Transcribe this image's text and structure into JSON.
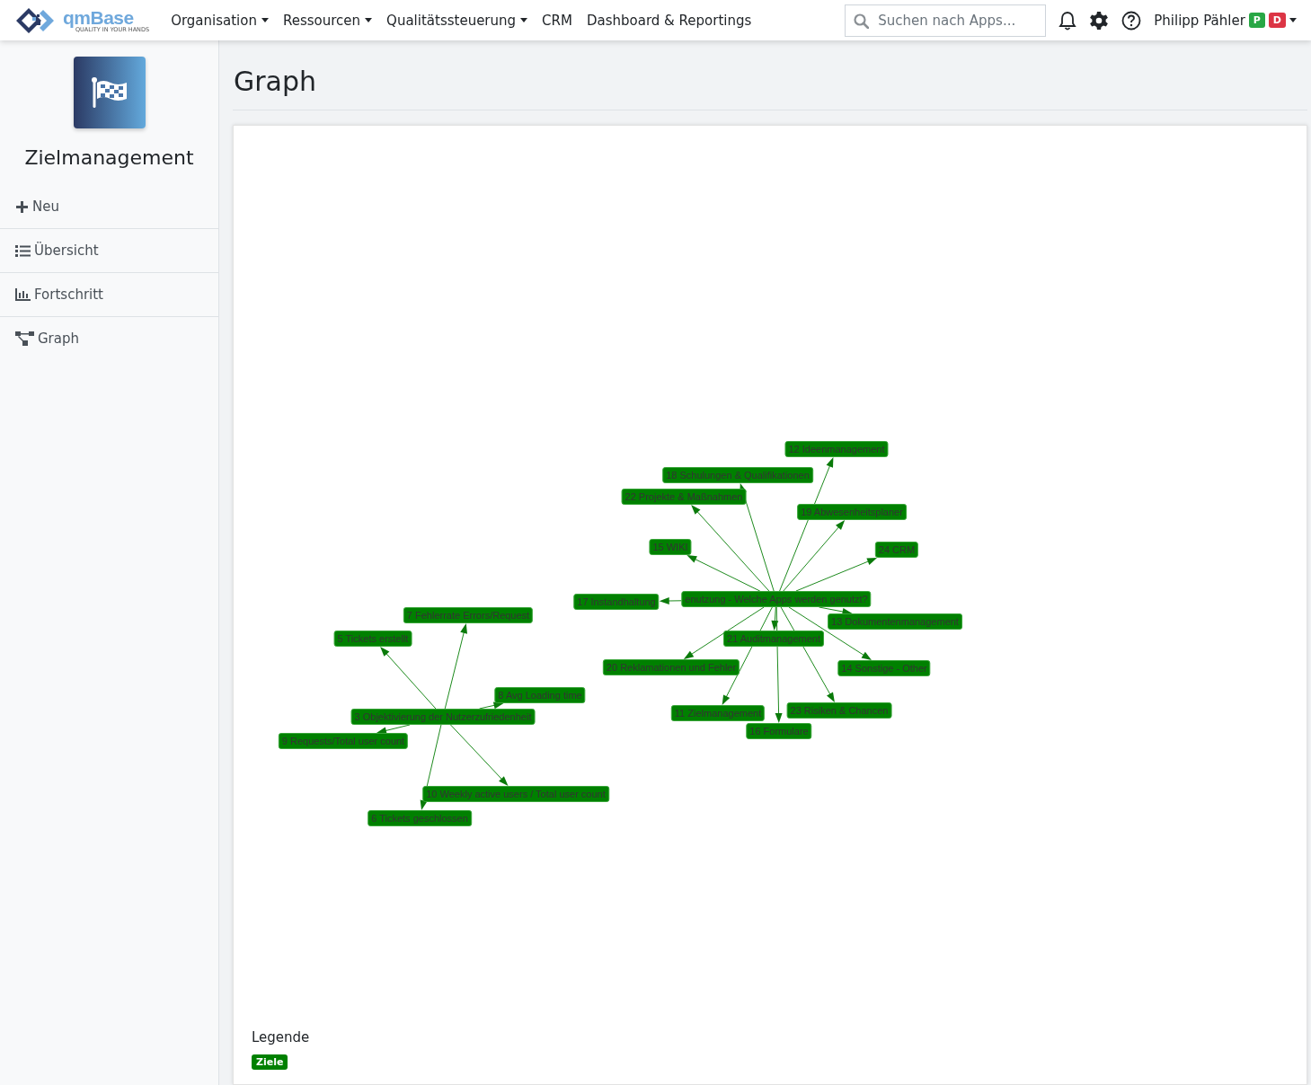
{
  "topbar": {
    "logo": {
      "name": "qmBase",
      "tagline": "QUALITY IN YOUR HANDS"
    },
    "menu": [
      {
        "label": "Organisation",
        "dropdown": true
      },
      {
        "label": "Ressourcen",
        "dropdown": true
      },
      {
        "label": "Qualitätssteuerung",
        "dropdown": true
      },
      {
        "label": "CRM",
        "dropdown": false
      },
      {
        "label": "Dashboard & Reportings",
        "dropdown": false
      }
    ],
    "search": {
      "placeholder": "Suchen nach Apps..."
    },
    "user": {
      "name": "Philipp Pähler",
      "badges": [
        {
          "label": "P",
          "color": "#28a745"
        },
        {
          "label": "D",
          "color": "#dc3545"
        }
      ]
    }
  },
  "sidebar": {
    "app_title": "Zielmanagement",
    "items": [
      {
        "label": "Neu",
        "kind": "plus"
      },
      {
        "label": "Übersicht",
        "kind": "list"
      },
      {
        "label": "Fortschritt",
        "kind": "chart"
      },
      {
        "label": "Graph",
        "kind": "graph"
      }
    ]
  },
  "page": {
    "title": "Graph"
  },
  "graph": {
    "nodes": [
      {
        "label": "3 Objektivierung der Nutzerzufriedenheit",
        "children": [
          {
            "label": "7 Fehlerrate Errors/Request"
          },
          {
            "label": "5 Tickets erstellt"
          },
          {
            "label": "8 Avg Loading time"
          },
          {
            "label": "9 Requests/Total user count"
          },
          {
            "label": "10 Weekly active users / Total user count"
          },
          {
            "label": "6 Tickets geschlossen"
          }
        ]
      },
      {
        "label": "enutzung - Welche Apps werden genutzt?",
        "children": [
          {
            "label": "12 Ideenmanagement"
          },
          {
            "label": "18 Schulungen & Qualifikationen"
          },
          {
            "label": "22 Projekte & Maßnahmen"
          },
          {
            "label": "19 Abwesenheitsplaner"
          },
          {
            "label": "15 WIKI"
          },
          {
            "label": "24 CRM"
          },
          {
            "label": "17 Instandhaltung"
          },
          {
            "label": "13 Dokumentenmanagement"
          },
          {
            "label": "21 Auditmanagement"
          },
          {
            "label": "20 Reklamationen und Fehler"
          },
          {
            "label": "14 Sonstige - Other"
          },
          {
            "label": "11 Zielmanagement"
          },
          {
            "label": "23 Risiken & Chancen"
          },
          {
            "label": "16 Formulare"
          }
        ]
      }
    ],
    "legend": {
      "title": "Legende",
      "items": [
        {
          "label": "Ziele",
          "color": "#008000"
        }
      ]
    }
  }
}
